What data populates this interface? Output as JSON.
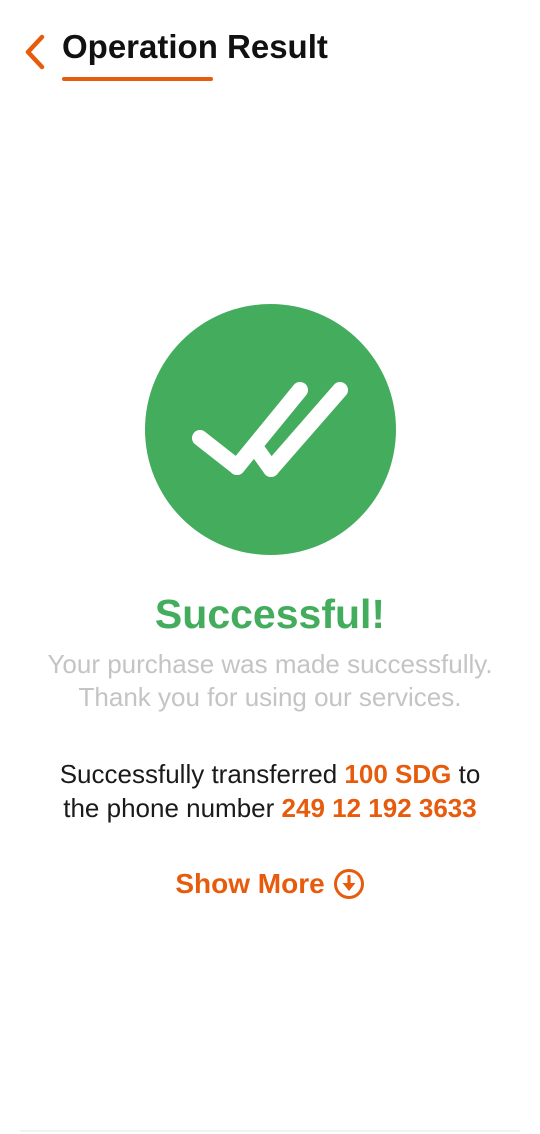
{
  "colors": {
    "accent": "#e65c0c",
    "success": "#43ad5d",
    "muted_text": "#c4c4c4"
  },
  "header": {
    "back_icon": "chevron-left-icon",
    "title": "Operation Result"
  },
  "result": {
    "status_icon": "double-check-icon",
    "heading": "Successful!",
    "message_line1": "Your purchase was made successfully.",
    "message_line2": "Thank you for using our services.",
    "transfer_prefix": "Successfully transferred",
    "amount": "100 SDG",
    "transfer_middle": "to",
    "phone_prefix": "the phone number",
    "phone_number": "249 12 192 3633"
  },
  "actions": {
    "show_more_label": "Show More",
    "show_more_icon": "arrow-down-circle-icon"
  }
}
